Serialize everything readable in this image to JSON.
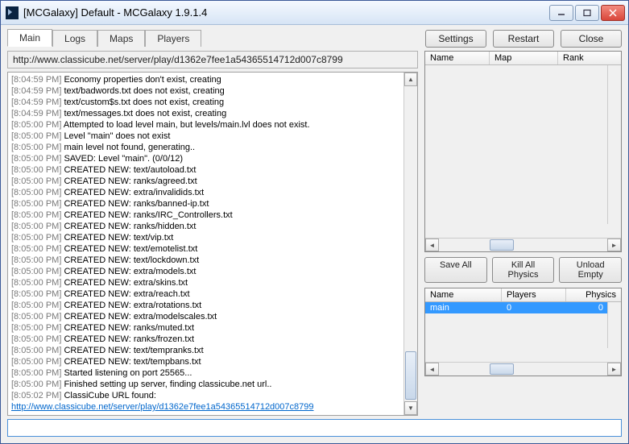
{
  "window": {
    "title": "[MCGalaxy] Default - MCGalaxy 1.9.1.4"
  },
  "tabs": {
    "items": [
      {
        "label": "Main"
      },
      {
        "label": "Logs"
      },
      {
        "label": "Maps"
      },
      {
        "label": "Players"
      }
    ]
  },
  "topButtons": {
    "settings": "Settings",
    "restart": "Restart",
    "close": "Close"
  },
  "url": "http://www.classicube.net/server/play/d1362e7fee1a54365514712d007c8799",
  "log": [
    {
      "ts": "[8:04:59 PM]",
      "text": "Economy properties don't exist, creating"
    },
    {
      "ts": "[8:04:59 PM]",
      "text": "text/badwords.txt does not exist, creating"
    },
    {
      "ts": "[8:04:59 PM]",
      "text": "text/custom$s.txt does not exist, creating"
    },
    {
      "ts": "[8:04:59 PM]",
      "text": "text/messages.txt does not exist, creating"
    },
    {
      "ts": "[8:05:00 PM]",
      "text": "Attempted to load level main, but levels/main.lvl does not exist."
    },
    {
      "ts": "[8:05:00 PM]",
      "text": "Level \"main\" does not exist"
    },
    {
      "ts": "[8:05:00 PM]",
      "text": "main level not found, generating.."
    },
    {
      "ts": "[8:05:00 PM]",
      "text": "SAVED: Level \"main\". (0/0/12)"
    },
    {
      "ts": "[8:05:00 PM]",
      "text": "CREATED NEW: text/autoload.txt"
    },
    {
      "ts": "[8:05:00 PM]",
      "text": "CREATED NEW: ranks/agreed.txt"
    },
    {
      "ts": "[8:05:00 PM]",
      "text": "CREATED NEW: extra/invalidids.txt"
    },
    {
      "ts": "[8:05:00 PM]",
      "text": "CREATED NEW: ranks/banned-ip.txt"
    },
    {
      "ts": "[8:05:00 PM]",
      "text": "CREATED NEW: ranks/IRC_Controllers.txt"
    },
    {
      "ts": "[8:05:00 PM]",
      "text": "CREATED NEW: ranks/hidden.txt"
    },
    {
      "ts": "[8:05:00 PM]",
      "text": "CREATED NEW: text/vip.txt"
    },
    {
      "ts": "[8:05:00 PM]",
      "text": "CREATED NEW: text/emotelist.txt"
    },
    {
      "ts": "[8:05:00 PM]",
      "text": "CREATED NEW: text/lockdown.txt"
    },
    {
      "ts": "[8:05:00 PM]",
      "text": "CREATED NEW: extra/models.txt"
    },
    {
      "ts": "[8:05:00 PM]",
      "text": "CREATED NEW: extra/skins.txt"
    },
    {
      "ts": "[8:05:00 PM]",
      "text": "CREATED NEW: extra/reach.txt"
    },
    {
      "ts": "[8:05:00 PM]",
      "text": "CREATED NEW: extra/rotations.txt"
    },
    {
      "ts": "[8:05:00 PM]",
      "text": "CREATED NEW: extra/modelscales.txt"
    },
    {
      "ts": "[8:05:00 PM]",
      "text": "CREATED NEW: ranks/muted.txt"
    },
    {
      "ts": "[8:05:00 PM]",
      "text": "CREATED NEW: ranks/frozen.txt"
    },
    {
      "ts": "[8:05:00 PM]",
      "text": "CREATED NEW: text/tempranks.txt"
    },
    {
      "ts": "[8:05:00 PM]",
      "text": "CREATED NEW: text/tempbans.txt"
    },
    {
      "ts": "[8:05:00 PM]",
      "text": "Started listening on port 25565..."
    },
    {
      "ts": "[8:05:00 PM]",
      "text": "Finished setting up server, finding classicube.net url.."
    },
    {
      "ts": "[8:05:02 PM]",
      "text": "ClassiCube URL found:"
    }
  ],
  "logLink": "http://www.classicube.net/server/play/d1362e7fee1a54365514712d007c8799",
  "playersGrid": {
    "columns": {
      "name": "Name",
      "map": "Map",
      "rank": "Rank"
    }
  },
  "midButtons": {
    "saveAll": "Save All",
    "killPhysics": "Kill All Physics",
    "unloadEmpty": "Unload Empty"
  },
  "levelsGrid": {
    "columns": {
      "name": "Name",
      "players": "Players",
      "physics": "Physics"
    },
    "rows": [
      {
        "name": "main",
        "players": "0",
        "physics": "0"
      }
    ]
  },
  "command": {
    "value": ""
  }
}
